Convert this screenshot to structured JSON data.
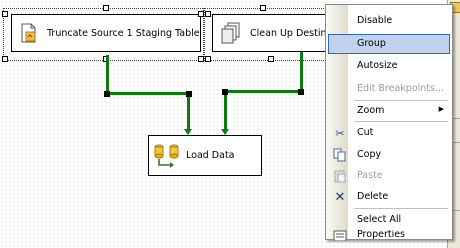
{
  "tasks": {
    "truncate": {
      "label": "Truncate Source 1 Staging Tables"
    },
    "cleanup": {
      "label": "Clean Up Destinatio"
    },
    "load": {
      "label": "Load Data"
    }
  },
  "context_menu": {
    "items": [
      {
        "label": "Disable",
        "enabled": true
      },
      {
        "label": "Group",
        "enabled": true,
        "highlighted": true
      },
      {
        "label": "Autosize",
        "enabled": true
      },
      {
        "label": "Edit Breakpoints...",
        "enabled": false
      },
      {
        "label": "Zoom",
        "enabled": true,
        "submenu": true
      },
      {
        "label": "Cut",
        "enabled": true,
        "icon": "scissors-icon"
      },
      {
        "label": "Copy",
        "enabled": true,
        "icon": "copy-icon"
      },
      {
        "label": "Paste",
        "enabled": false,
        "icon": "paste-icon"
      },
      {
        "label": "Delete",
        "enabled": true,
        "icon": "delete-x-icon"
      },
      {
        "label": "Select All",
        "enabled": true
      },
      {
        "label": "Properties",
        "enabled": true,
        "icon": "properties-icon"
      }
    ]
  },
  "colors": {
    "connector": "#0b7d0b",
    "menu_highlight": "#c1d2ee",
    "menu_highlight_border": "#316ac5"
  }
}
